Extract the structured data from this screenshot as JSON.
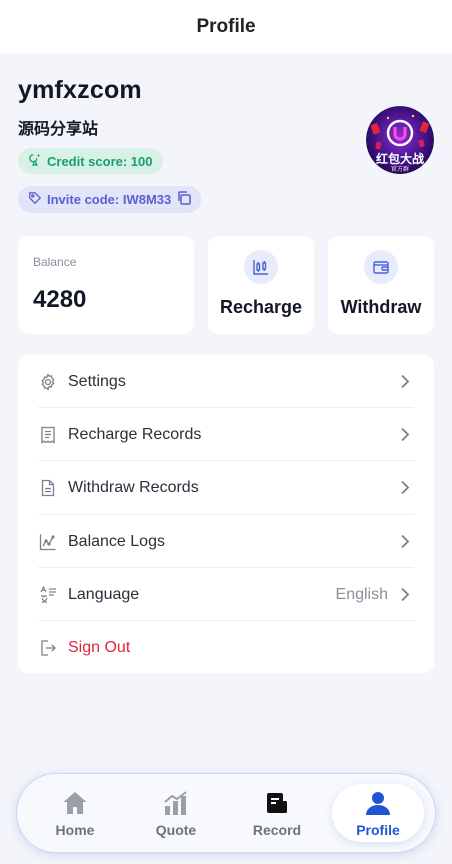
{
  "header": {
    "title": "Profile"
  },
  "profile": {
    "username": "ymfxzcom",
    "nickname": "源码分享站",
    "credit_label": "Credit score: 100",
    "invite_label": "Invite code: IW8M33",
    "avatar_text": "红包大战",
    "avatar_subtext": "官方群"
  },
  "wallet": {
    "balance_label": "Balance",
    "balance_value": "4280",
    "recharge_label": "Recharge",
    "withdraw_label": "Withdraw"
  },
  "menu": {
    "items": [
      {
        "label": "Settings",
        "icon": "gear-icon"
      },
      {
        "label": "Recharge Records",
        "icon": "receipt-icon"
      },
      {
        "label": "Withdraw Records",
        "icon": "document-icon"
      },
      {
        "label": "Balance Logs",
        "icon": "chart-icon"
      },
      {
        "label": "Language",
        "icon": "language-icon",
        "value": "English"
      },
      {
        "label": "Sign Out",
        "icon": "logout-icon"
      }
    ]
  },
  "tabbar": {
    "tabs": [
      {
        "label": "Home",
        "icon": "home-icon"
      },
      {
        "label": "Quote",
        "icon": "bar-chart-icon"
      },
      {
        "label": "Record",
        "icon": "record-icon"
      },
      {
        "label": "Profile",
        "icon": "user-icon",
        "active": true
      }
    ]
  },
  "colors": {
    "accent": "#1f55d4",
    "credit_text": "#16a06b",
    "credit_bg": "#d7f1e6",
    "invite_text": "#5b5fd0",
    "invite_bg": "#e2e4f8",
    "signout": "#e0263a"
  }
}
